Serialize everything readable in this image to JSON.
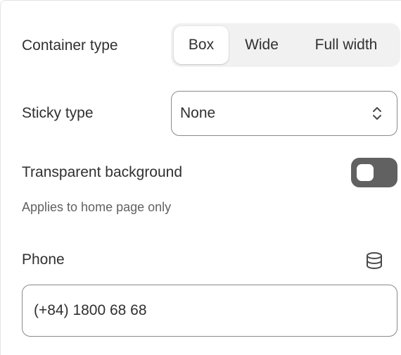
{
  "container_type": {
    "label": "Container type",
    "options": [
      "Box",
      "Wide",
      "Full width"
    ],
    "selected": "Box"
  },
  "sticky_type": {
    "label": "Sticky type",
    "value": "None"
  },
  "transparent_background": {
    "label": "Transparent background",
    "hint": "Applies to home page only",
    "enabled": false
  },
  "phone": {
    "label": "Phone",
    "value": "(+84) 1800 68 68",
    "icon": "database-icon"
  }
}
